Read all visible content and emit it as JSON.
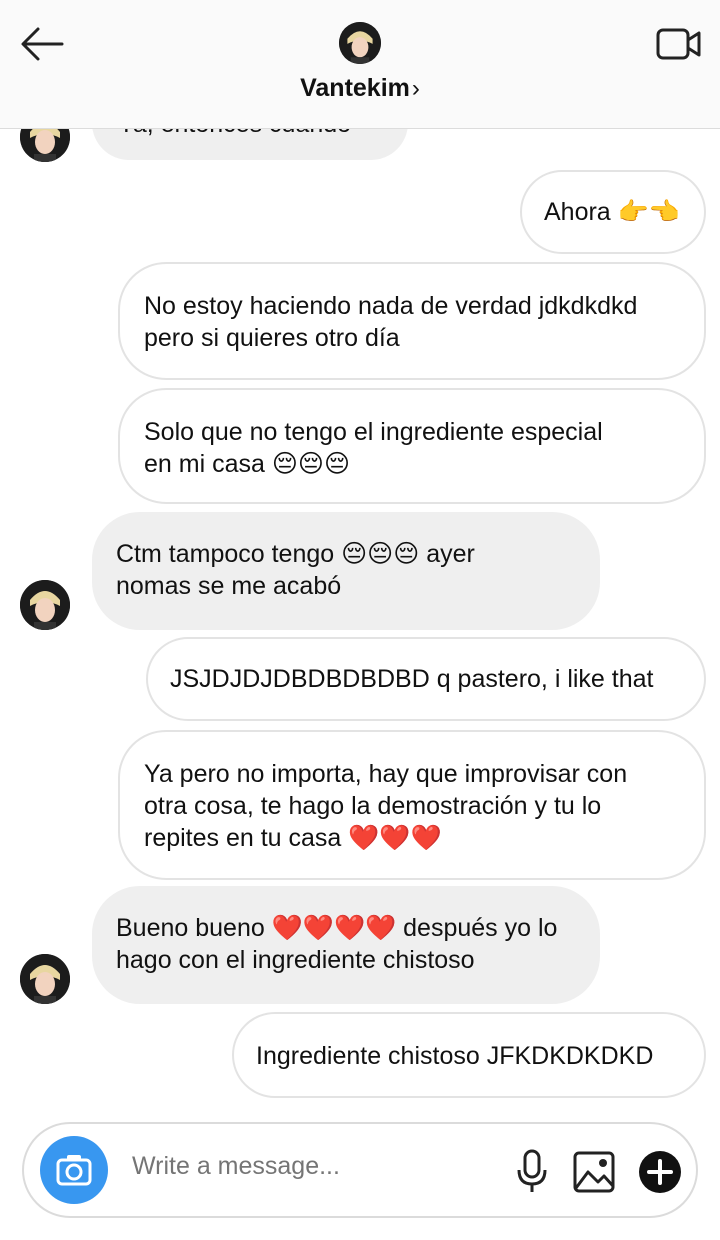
{
  "header": {
    "username": "Vantekim",
    "chevron": "›",
    "icons": [
      "back-arrow-icon",
      "video-call-icon"
    ]
  },
  "messages": [
    {
      "side": "in",
      "text_top": "Ya, entonces cuando"
    },
    {
      "side": "out",
      "text": "Ahora 👉👈"
    },
    {
      "side": "out",
      "line1": "No estoy haciendo nada de verdad jdkdkdkd",
      "line2": "pero si quieres otro día"
    },
    {
      "side": "out",
      "line1": "Solo que no tengo el ingrediente especial",
      "line2": "en mi casa 😔😔😔"
    },
    {
      "side": "in",
      "line1": "Ctm tampoco tengo 😔😔😔 ayer",
      "line2": "nomas se me acabó"
    },
    {
      "side": "out",
      "text": "JSJDJDJDBDBDBDBD q pastero, i like that"
    },
    {
      "side": "out",
      "line1": "Ya pero no importa, hay que improvisar con",
      "line2": "otra cosa, te hago la demostración y tu lo",
      "line3": "repites en tu casa ❤️❤️❤️"
    },
    {
      "side": "in",
      "line1": "Bueno bueno ❤️❤️❤️❤️ después yo lo",
      "line2": "hago con el ingrediente chistoso"
    },
    {
      "side": "out",
      "text": "Ingrediente chistoso JFKDKDKDKD"
    }
  ],
  "composer": {
    "placeholder": "Write a message...",
    "icons": [
      "camera-icon",
      "microphone-icon",
      "gallery-icon",
      "add-icon"
    ]
  },
  "colors": {
    "camera_button": "#3897f0",
    "incoming_bubble": "#efefef",
    "outgoing_border": "#e3e3e3"
  }
}
